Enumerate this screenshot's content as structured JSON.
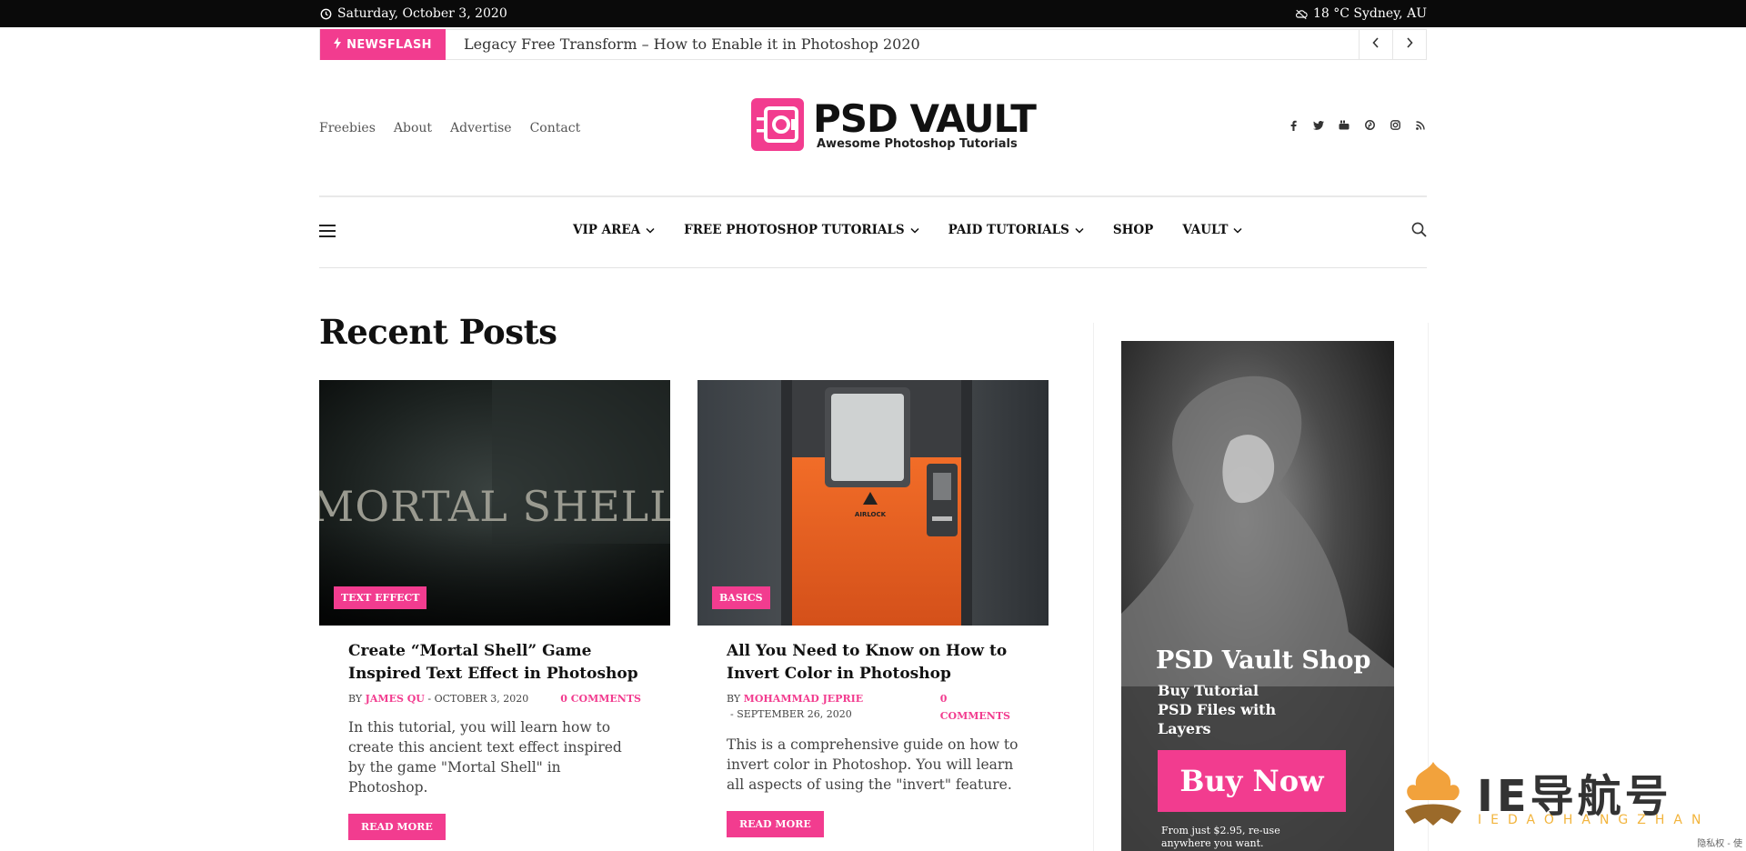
{
  "topbar": {
    "date": "Saturday, October 3, 2020",
    "weather": "18 °C Sydney, AU"
  },
  "newsflash": {
    "label": "NEWSFLASH",
    "headline": "Legacy Free Transform – How to Enable it in Photoshop 2020"
  },
  "header": {
    "links": [
      "Freebies",
      "About",
      "Advertise",
      "Contact"
    ],
    "logo_name": "PSD VAULT",
    "logo_tagline": "Awesome Photoshop Tutorials",
    "social": [
      "facebook-icon",
      "twitter-icon",
      "youtube-icon",
      "pinterest-icon",
      "instagram-icon",
      "rss-icon"
    ]
  },
  "nav": {
    "items": [
      {
        "label": "VIP AREA",
        "dropdown": true
      },
      {
        "label": "FREE PHOTOSHOP TUTORIALS",
        "dropdown": true
      },
      {
        "label": "PAID TUTORIALS",
        "dropdown": true
      },
      {
        "label": "SHOP",
        "dropdown": false
      },
      {
        "label": "VAULT",
        "dropdown": true
      }
    ]
  },
  "main": {
    "heading": "Recent Posts",
    "posts": [
      {
        "category": "TEXT EFFECT",
        "title": "Create “Mortal Shell” Game Inspired Text Effect in Photoshop",
        "by": "BY",
        "author": "JAMES QU",
        "date": "- OCTOBER 3, 2020",
        "comments": "0 COMMENTS",
        "excerpt": "In this tutorial, you will learn how to create this ancient text effect inspired by the game \"Mortal Shell\" in Photoshop.",
        "read_more": "READ MORE",
        "image_text": "MORTAL SHELL"
      },
      {
        "category": "BASICS",
        "title": "All You Need to Know on How to Invert Color in Photoshop",
        "by": "BY",
        "author": "MOHAMMAD JEPRIE",
        "date": "- SEPTEMBER 26, 2020",
        "comments_line1": "0",
        "comments_line2": "COMMENTS",
        "excerpt": "This is a comprehensive guide on how to invert color in Photoshop. You will learn all aspects of using the \"invert\" feature.",
        "read_more": "READ MORE",
        "image_text": "AIRLOCK"
      }
    ]
  },
  "sidebar": {
    "ad_title": "PSD Vault Shop",
    "ad_sub": [
      "Buy Tutorial",
      "PSD Files with",
      "Layers"
    ],
    "ad_button": "Buy Now",
    "ad_foot": [
      "From just $2.95, re-use",
      "anywhere you want."
    ]
  },
  "watermark": {
    "text": "IE导航号",
    "sub": "IEDAOHANGZHAN",
    "corner": "隐私权 - 使"
  },
  "colors": {
    "accent": "#f23c8f",
    "topbar": "#0a0a0a"
  }
}
